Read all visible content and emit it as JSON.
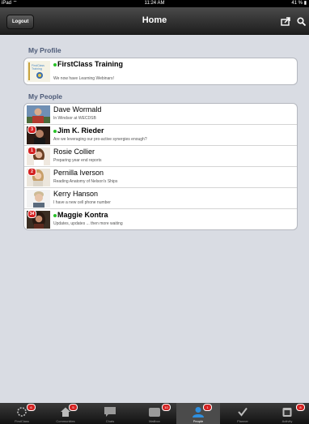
{
  "status_bar": {
    "carrier": "iPad",
    "time": "11:24 AM",
    "battery": "41 %"
  },
  "nav": {
    "title": "Home",
    "logout_label": "Logout"
  },
  "profile": {
    "section_title": "My Profile",
    "name": "FirstClass Training",
    "subtitle": "We now have Learning Webinars!",
    "logo_text": "FirstClass Training",
    "online": true
  },
  "people": {
    "section_title": "My People",
    "items": [
      {
        "name": "Dave Wormald",
        "subtitle": "In Windsor at WECDSB",
        "badge": "",
        "online": false
      },
      {
        "name": "Jim K. Rieder",
        "subtitle": "Are we leveraging our pro-active synergies enough?",
        "badge": "3",
        "online": true
      },
      {
        "name": "Rosie Collier",
        "subtitle": "Preparing year end reports",
        "badge": "1",
        "online": false
      },
      {
        "name": "Pernilla Iverson",
        "subtitle": "Reading Anatomy of Nelson's Ships",
        "badge": "2",
        "online": false
      },
      {
        "name": "Kerry Hanson",
        "subtitle": "I have a new cell phone number",
        "badge": "",
        "online": false
      },
      {
        "name": "Maggie Kontra",
        "subtitle": "Updates, updates ... then more waiting",
        "badge": "34",
        "online": true
      }
    ]
  },
  "tab_bar": {
    "tabs": [
      {
        "label": "FirstClass",
        "icon": "spinner-icon",
        "badge": "6"
      },
      {
        "label": "Communities",
        "icon": "house-icon",
        "badge": "5"
      },
      {
        "label": "Chats",
        "icon": "chat-bubble-icon",
        "badge": ""
      },
      {
        "label": "Mailbox",
        "icon": "mail-tray-icon",
        "badge": "10"
      },
      {
        "label": "People",
        "icon": "person-icon",
        "badge": "1",
        "active": true
      },
      {
        "label": "Planner",
        "icon": "checkmark-icon",
        "badge": ""
      },
      {
        "label": "Activity",
        "icon": "calendar-icon",
        "badge": "8"
      }
    ]
  }
}
